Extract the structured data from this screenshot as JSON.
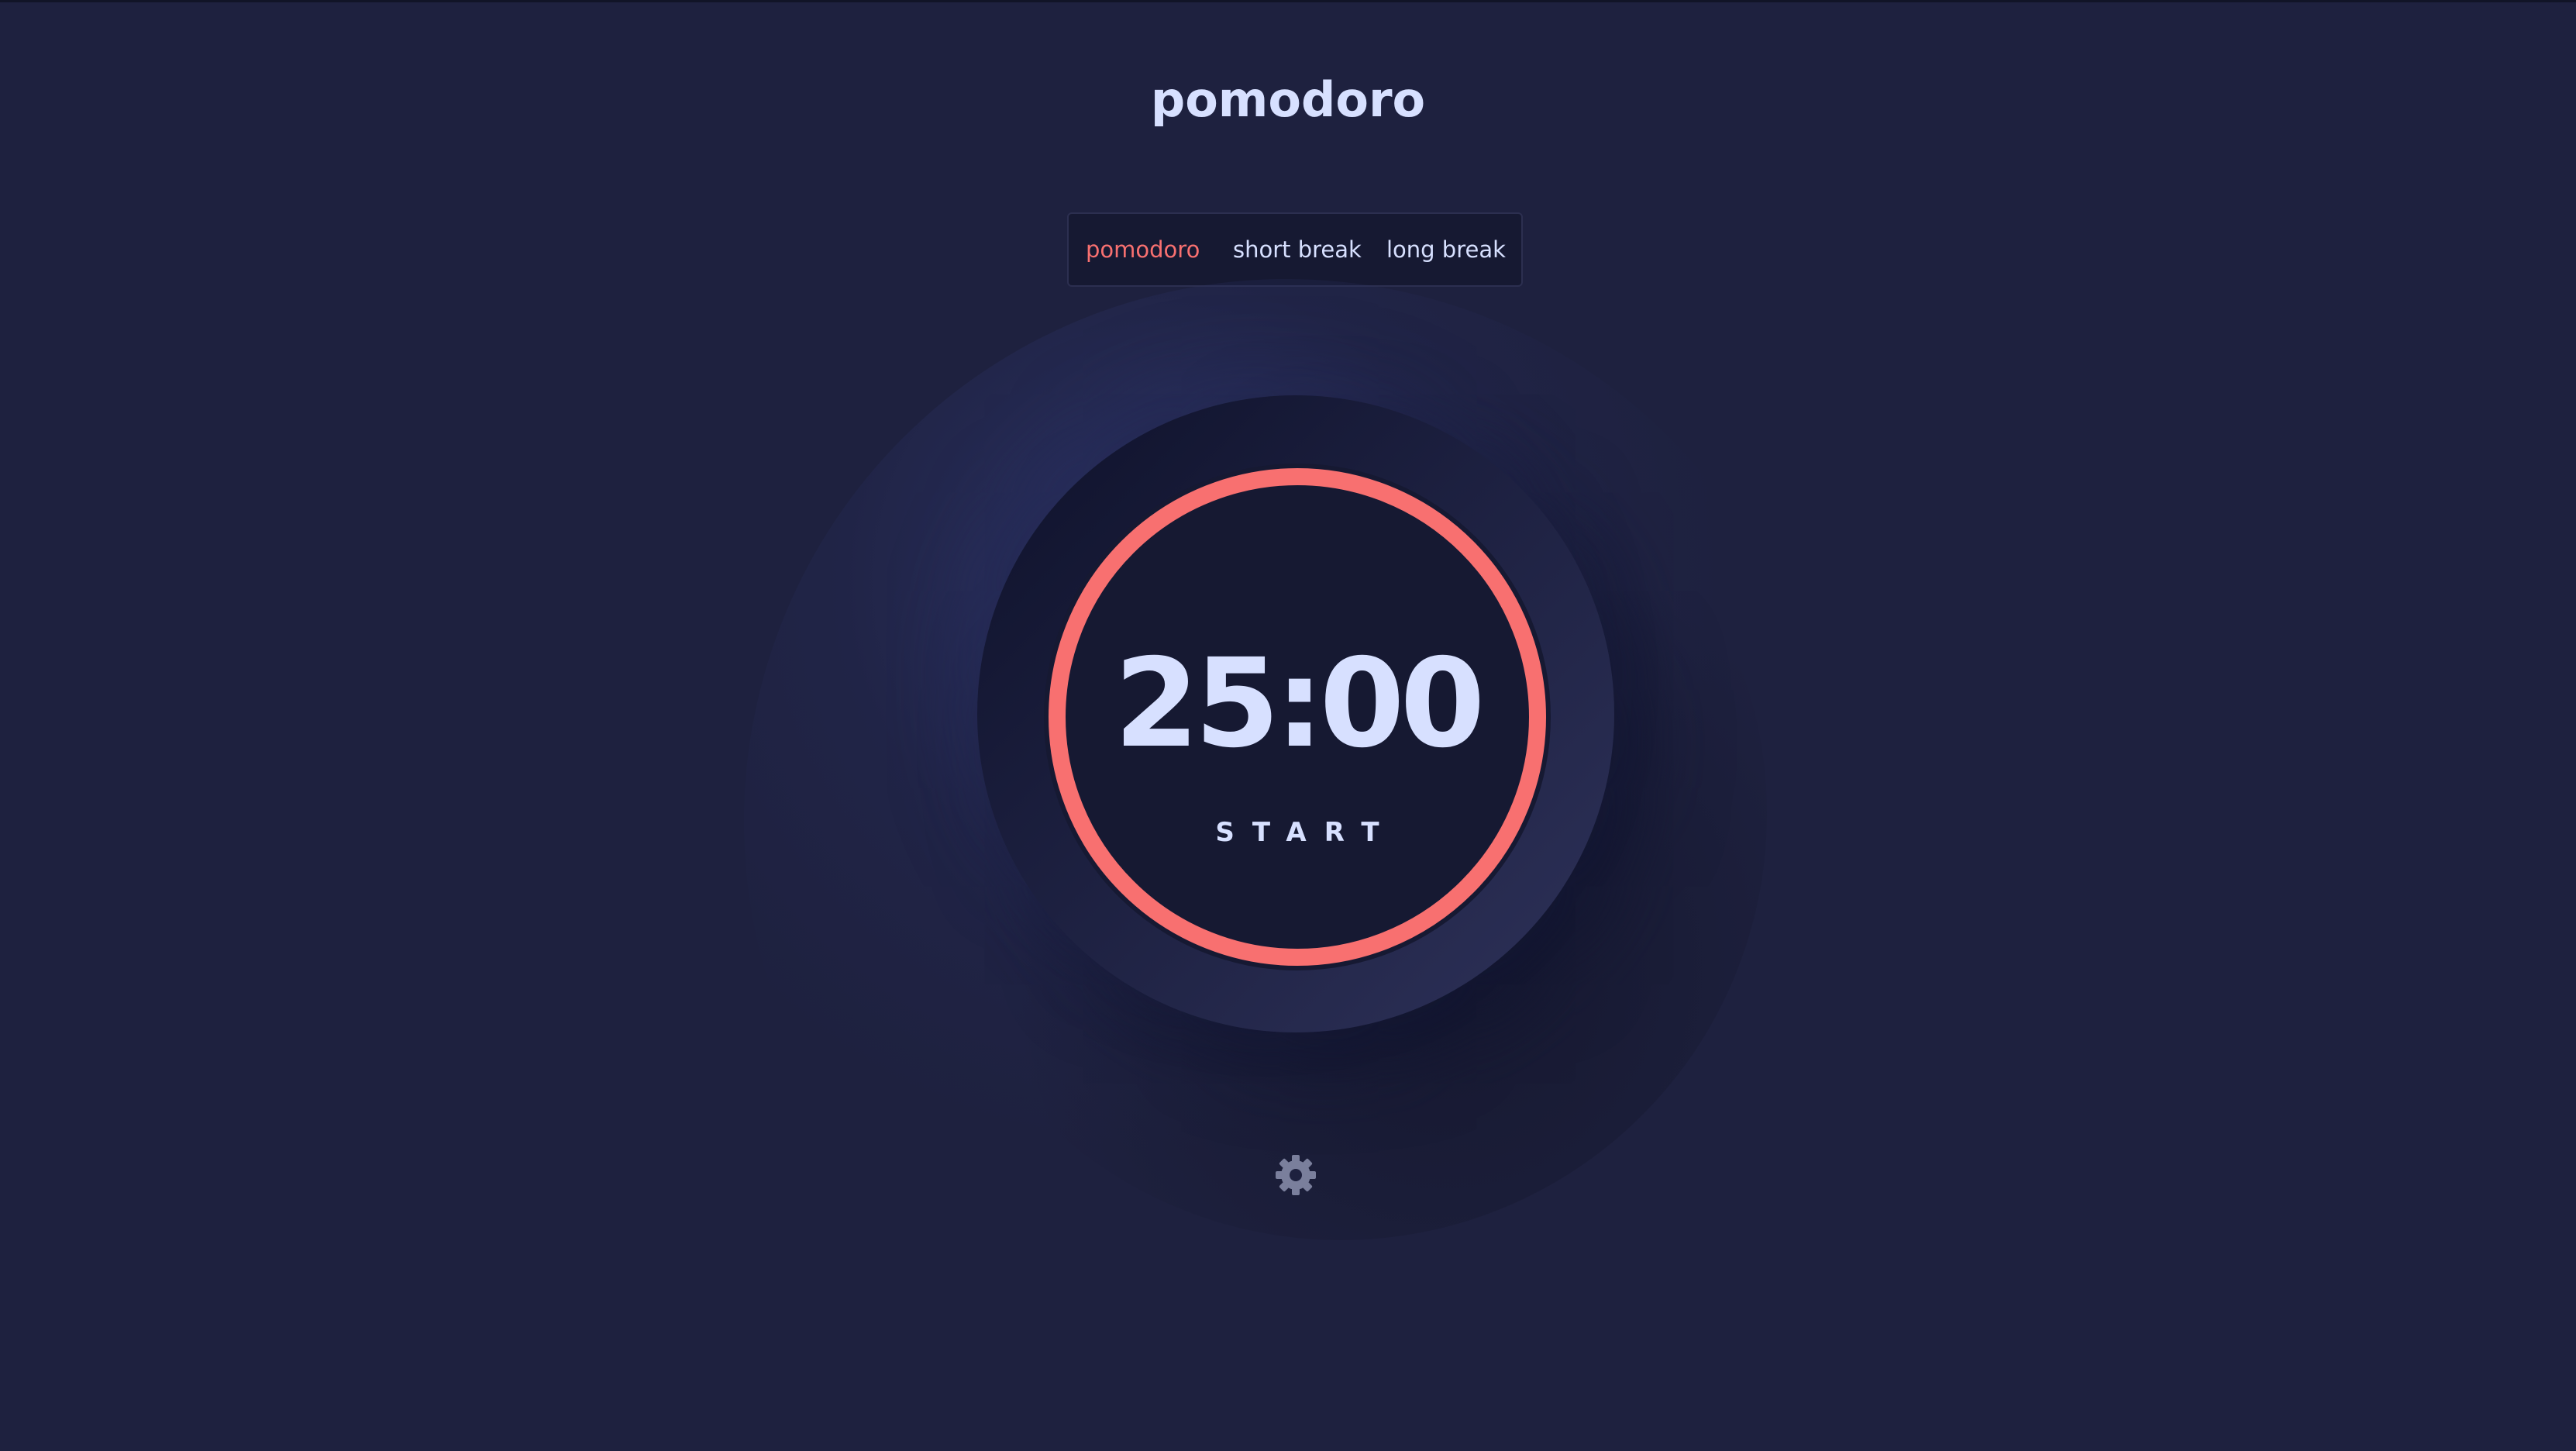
{
  "app": {
    "title": "pomodoro"
  },
  "modes": [
    {
      "label": "pomodoro",
      "active": true
    },
    {
      "label": "short break",
      "active": false
    },
    {
      "label": "long break",
      "active": false
    }
  ],
  "timer": {
    "display": "25:00",
    "progress": 1.0,
    "action_label": "START"
  },
  "settings": {
    "icon": "gear-icon"
  },
  "colors": {
    "background": "#1e213f",
    "accent": "#f87070",
    "text": "#d7e0ff",
    "panel": "#161932",
    "icon": "#7a7f9c"
  }
}
